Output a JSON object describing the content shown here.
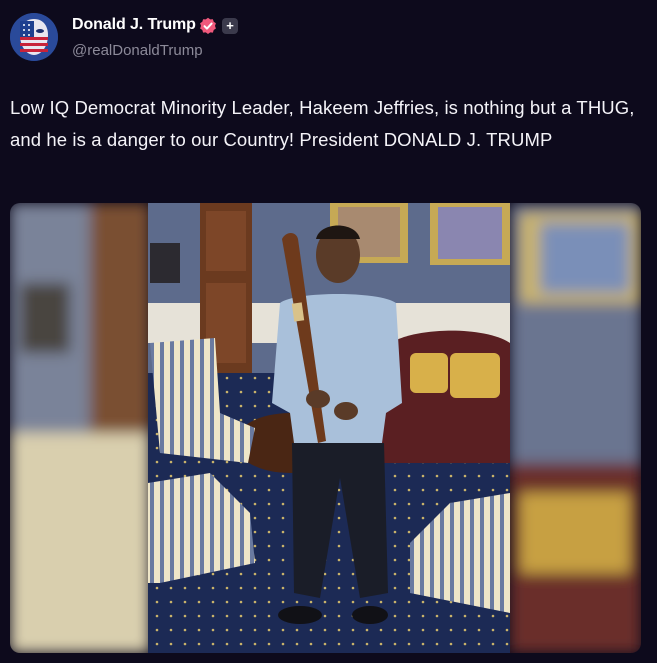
{
  "post": {
    "author": {
      "display_name": "Donald J. Trump",
      "handle": "@realDonaldTrump",
      "verified_color": "#f0597c",
      "avatar_icon": "american-flag-portrait-icon"
    },
    "follow_icon": "plus-icon",
    "text": "Low IQ Democrat Minority Leader, Hakeem Jeffries, is nothing but a THUG, and he is a danger to our Country! President DONALD J. TRUMP",
    "media": {
      "icon": "photo-of-man-holding-baseball-bat"
    }
  },
  "colors": {
    "background": "#0d0a1c",
    "text": "#f4f3f8",
    "muted": "#8c8a99"
  }
}
